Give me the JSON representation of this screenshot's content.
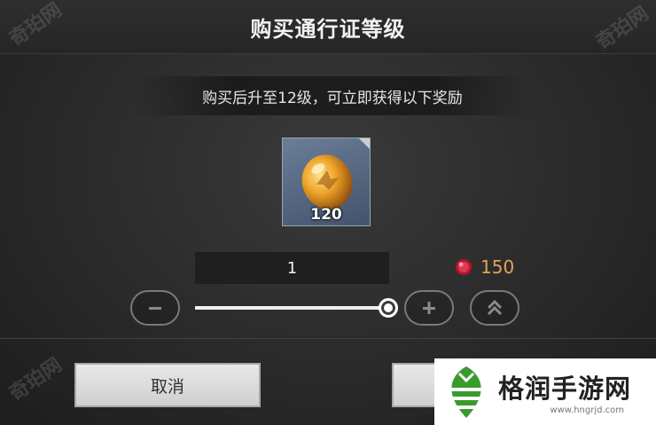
{
  "header": {
    "title": "购买通行证等级"
  },
  "watermarks": {
    "top_left": "奇珀网",
    "top_right": "奇珀网",
    "bottom_left": "奇珀网"
  },
  "description": "购买后升至12级，可立即获得以下奖励",
  "reward": {
    "icon": "amber-gem-icon",
    "quantity": "120"
  },
  "purchase": {
    "quantity": "1",
    "price": "150",
    "currency_icon": "red-gem-icon",
    "slider_fraction": 1.0
  },
  "controls": {
    "decrease_icon": "minus-icon",
    "increase_icon": "plus-icon",
    "max_icon": "double-chevron-up-icon"
  },
  "buttons": {
    "cancel": "取消"
  },
  "banner": {
    "brand": "格润手游网",
    "url": "www.hngrjd.com"
  },
  "colors": {
    "price": "#e2a25e",
    "background": "#2a2a2a",
    "tile": "#55657d",
    "button": "#dcdcdc",
    "banner_green": "#3a9b2c"
  }
}
